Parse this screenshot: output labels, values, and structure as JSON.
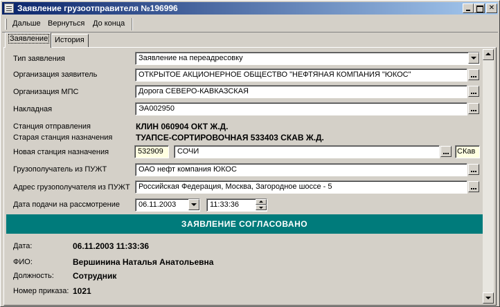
{
  "window": {
    "title": "Заявление грузоотправителя №196996"
  },
  "menu": {
    "next": "Дальше",
    "back": "Вернуться",
    "to_end": "До конца"
  },
  "tabs": {
    "statement": "Заявление",
    "history": "История"
  },
  "form": {
    "type_label": "Тип заявления",
    "type_value": "Заявление на переадресовку",
    "org_applicant_label": "Организация заявитель",
    "org_applicant_value": "ОТКРЫТОЕ АКЦИОНЕРНОЕ ОБЩЕСТВО \"НЕФТЯНАЯ КОМПАНИЯ \"ЮКОС\"",
    "org_mps_label": "Организация МПС",
    "org_mps_value": "Дорога СЕВЕРО-КАВКАЗСКАЯ",
    "waybill_label": "Накладная",
    "waybill_value": "ЭА002950",
    "departure_label": "Станция отправления",
    "departure_value": "КЛИН 060904 ОКТ Ж.Д.",
    "old_dest_label": "Старая станция назначения",
    "old_dest_value": "ТУАПСЕ-СОРТИРОВОЧНАЯ 533403 СКАВ Ж.Д.",
    "new_dest_label": "Новая станция назначения",
    "new_dest_code": "532909",
    "new_dest_name": "СОЧИ",
    "new_dest_road": "СКав",
    "consignee_label": "Грузополучатель из ПУЖТ",
    "consignee_value": "ОАО нефт компания ЮКОС",
    "consignee_addr_label": "Адрес грузополучателя из ПУЖТ",
    "consignee_addr_value": "Российская Федерация, Москва, Загородное шоссе - 5",
    "submit_date_label": "Дата подачи на рассмотрение",
    "submit_date_value": "06.11.2003",
    "submit_time_value": "11:33:36"
  },
  "status_banner": "ЗАЯВЛЕНИЕ СОГЛАСОВАНО",
  "approval": {
    "date_label": "Дата:",
    "date_value": "06.11.2003 11:33:36",
    "name_label": "ФИО:",
    "name_value": "Вершинина Наталья Анатольевна",
    "position_label": "Должность:",
    "position_value": "Сотрудник",
    "order_label": "Номер приказа:",
    "order_value": "1021"
  },
  "colors": {
    "banner": "#007b7b",
    "title_start": "#0a246a",
    "title_end": "#a6caf0",
    "window_face": "#d4d0c8"
  },
  "icons": {
    "window": "document-icon",
    "browse": "ellipsis-icon",
    "dropdown": "chevron-down-icon"
  }
}
